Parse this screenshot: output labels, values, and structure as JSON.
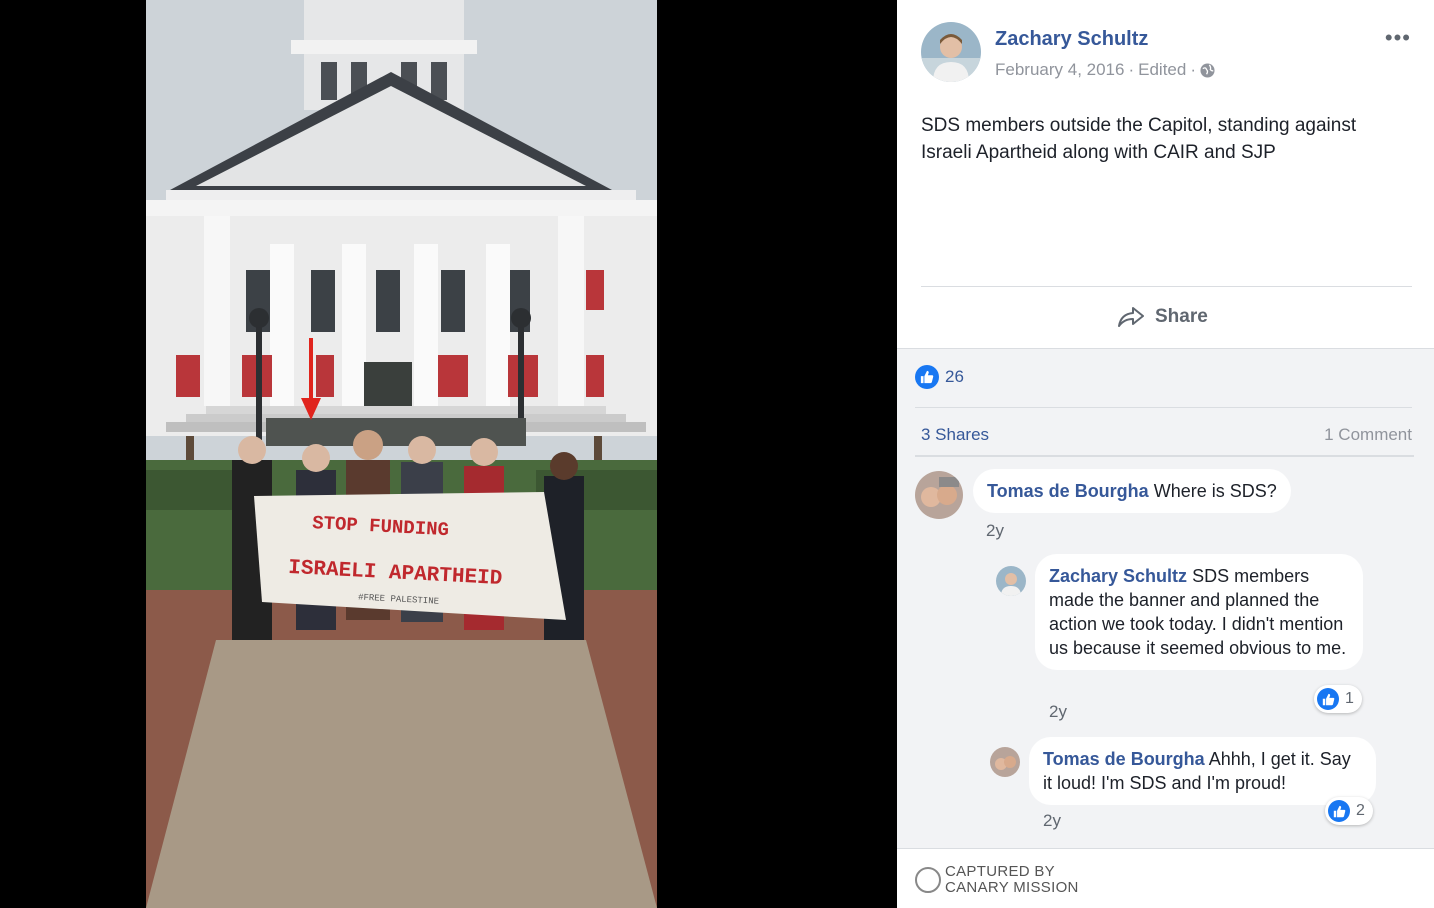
{
  "post": {
    "author": "Zachary Schultz",
    "date": "February 4, 2016",
    "separator": "·",
    "edited": "Edited",
    "separator2": "·",
    "privacy_icon": "globe-icon",
    "more_icon": "more-options-icon",
    "more_glyph": "•••",
    "text": "SDS members outside the Capitol, standing against Israeli Apartheid along with CAIR and SJP",
    "share_label": "Share",
    "like_count": "26",
    "shares_label": "3 Shares",
    "comments_label": "1 Comment"
  },
  "photo": {
    "banner_line1": "STOP FUNDING",
    "banner_line2": "ISRAELI APARTHEID",
    "banner_line3": "#FREE PALESTINE",
    "arrow_color": "#e0241d",
    "banner_text_color": "#c0282d"
  },
  "comments": [
    {
      "author": "Tomas de Bourgha",
      "text": "Where is SDS?",
      "time": "2y"
    },
    {
      "author": "Zachary Schultz",
      "text": "SDS members made the banner and planned the action we took today. I didn't mention us because it seemed obvious to me.",
      "time": "2y",
      "likes": "1"
    },
    {
      "author": "Tomas de Bourgha",
      "text": "Ahhh, I get it. Say it loud! I'm SDS and I'm proud!",
      "time": "2y",
      "likes": "2"
    }
  ],
  "footer": {
    "line1": "CAPTURED BY",
    "line2": "CANARY MISSION"
  },
  "colors": {
    "link_blue": "#365899",
    "like_blue": "#1877f2",
    "meta_gray": "#90949c"
  }
}
